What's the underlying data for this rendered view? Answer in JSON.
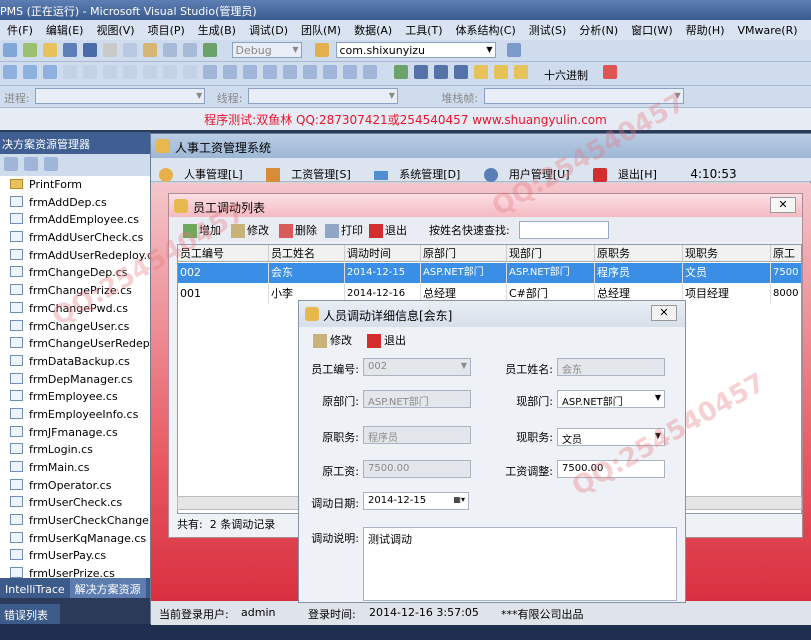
{
  "vs": {
    "title": "PMS (正在运行) - Microsoft Visual Studio(管理员)",
    "menu": [
      "件(F)",
      "编辑(E)",
      "视图(V)",
      "项目(P)",
      "生成(B)",
      "调试(D)",
      "团队(M)",
      "数据(A)",
      "工具(T)",
      "体系结构(C)",
      "测试(S)",
      "分析(N)",
      "窗口(W)",
      "帮助(H)",
      "VMware(R)"
    ],
    "config_combo": "Debug",
    "startup_combo": "com.shixunyizu",
    "hex_label": "十六进制",
    "debug_labels": {
      "process": "进程:",
      "thread": "线程:",
      "stack": "堆栈帧:"
    },
    "watermark_line": "程序测试:双鱼林 QQ:287307421或254540457 www.shuangyulin.com",
    "solution_title": "决方案资源管理器",
    "solution_items": [
      "PrintForm",
      "frmAddDep.cs",
      "frmAddEmployee.cs",
      "frmAddUserCheck.cs",
      "frmAddUserRedeploy.cs",
      "frmChangeDep.cs",
      "frmChangePrize.cs",
      "frmChangePwd.cs",
      "frmChangeUser.cs",
      "frmChangeUserRedeploy.cs",
      "frmDataBackup.cs",
      "frmDepManager.cs",
      "frmEmployee.cs",
      "frmEmployeeInfo.cs",
      "frmJFmanage.cs",
      "frmLogin.cs",
      "frmMain.cs",
      "frmOperator.cs",
      "frmUserCheck.cs",
      "frmUserCheckChange.cs",
      "frmUserKqManage.cs",
      "frmUserPay.cs",
      "frmUserPrize.cs"
    ],
    "bottom_tabs": [
      "IntelliTrace",
      "解决方案资源"
    ],
    "error_tab": "错误列表"
  },
  "app": {
    "title": "人事工资管理系统",
    "menu": [
      "人事管理[L]",
      "工资管理[S]",
      "系统管理[D]",
      "用户管理[U]",
      "退出[H]"
    ],
    "clock": "4:10:53",
    "status": {
      "user_label": "当前登录用户:",
      "user": "admin",
      "time_label": "登录时间:",
      "time": "2014-12-16 3:57:05",
      "company": "***有限公司出品"
    }
  },
  "list": {
    "title": "员工调动列表",
    "close": "✕",
    "toolbar": {
      "add": "增加",
      "edit": "修改",
      "delete": "删除",
      "print": "打印",
      "exit": "退出",
      "search_label": "按姓名快速查找:",
      "search_value": ""
    },
    "columns": [
      "员工编号",
      "员工姓名",
      "调动时间",
      "原部门",
      "现部门",
      "原职务",
      "现职务",
      "原工"
    ],
    "rows": [
      [
        "002",
        "会东",
        "2014-12-15",
        "ASP.NET部门",
        "ASP.NET部门",
        "程序员",
        "文员",
        "7500"
      ],
      [
        "001",
        "小李",
        "2014-12-16",
        "总经理",
        "C#部门",
        "总经理",
        "项目经理",
        "8000"
      ]
    ],
    "footer_prefix": "共有:",
    "footer_count": "2",
    "footer_suffix": "条调动记录"
  },
  "detail": {
    "title": "人员调动详细信息[会东]",
    "close": "✕",
    "toolbar": {
      "edit": "修改",
      "exit": "退出"
    },
    "fields": {
      "emp_id": {
        "label": "员工编号:",
        "value": "002"
      },
      "emp_name": {
        "label": "员工姓名:",
        "value": "会东"
      },
      "old_dept": {
        "label": "原部门:",
        "value": "ASP.NET部门"
      },
      "new_dept": {
        "label": "现部门:",
        "value": "ASP.NET部门"
      },
      "old_post": {
        "label": "原职务:",
        "value": "程序员"
      },
      "new_post": {
        "label": "现职务:",
        "value": "文员"
      },
      "old_pay": {
        "label": "原工资:",
        "value": "7500.00"
      },
      "pay_adjust": {
        "label": "工资调整:",
        "value": "7500.00"
      },
      "date": {
        "label": "调动日期:",
        "value": "2014-12-15"
      },
      "note": {
        "label": "调动说明:",
        "value": "测试调动"
      }
    }
  },
  "colors": {
    "accent_pink": "#e7535c",
    "select_blue": "#3a8ee6",
    "vs_blue": "#3f5e91",
    "watermark_red": "#e8132b"
  }
}
